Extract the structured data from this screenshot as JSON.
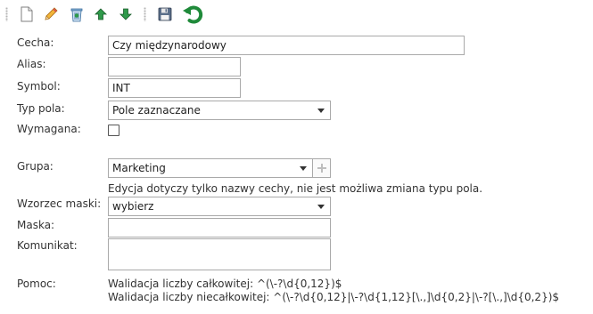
{
  "toolbar": {
    "icons": [
      "new-document-icon",
      "edit-pencil-icon",
      "recycle-bin-icon",
      "move-up-icon",
      "move-down-icon",
      "save-icon",
      "refresh-icon"
    ]
  },
  "form": {
    "cecha": {
      "label": "Cecha:",
      "value": "Czy międzynarodowy"
    },
    "alias": {
      "label": "Alias:",
      "value": ""
    },
    "symbol": {
      "label": "Symbol:",
      "value": "INT"
    },
    "typ_pola": {
      "label": "Typ pola:",
      "value": "Pole zaznaczane"
    },
    "wymagana": {
      "label": "Wymagana:",
      "checked": false
    },
    "grupa": {
      "label": "Grupa:",
      "value": "Marketing",
      "hint": "Edycja dotyczy tylko nazwy cechy, nie jest możliwa zmiana typu pola."
    },
    "wzorzec": {
      "label": "Wzorzec maski:",
      "value": "wybierz"
    },
    "maska": {
      "label": "Maska:",
      "value": ""
    },
    "komunikat": {
      "label": "Komunikat:",
      "value": ""
    },
    "pomoc": {
      "label": "Pomoc:",
      "line1": "Walidacja liczby całkowitej: ^(\\-?\\d{0,12})$",
      "line2": "Walidacja liczby niecałkowitej: ^(\\-?\\d{0,12}|\\-?\\d{1,12}[\\.,]\\d{0,2}|\\-?[\\.,]\\d{0,2})$"
    }
  },
  "colors": {
    "arrow_green": "#1f8a3a",
    "border": "#a9a9a9"
  }
}
